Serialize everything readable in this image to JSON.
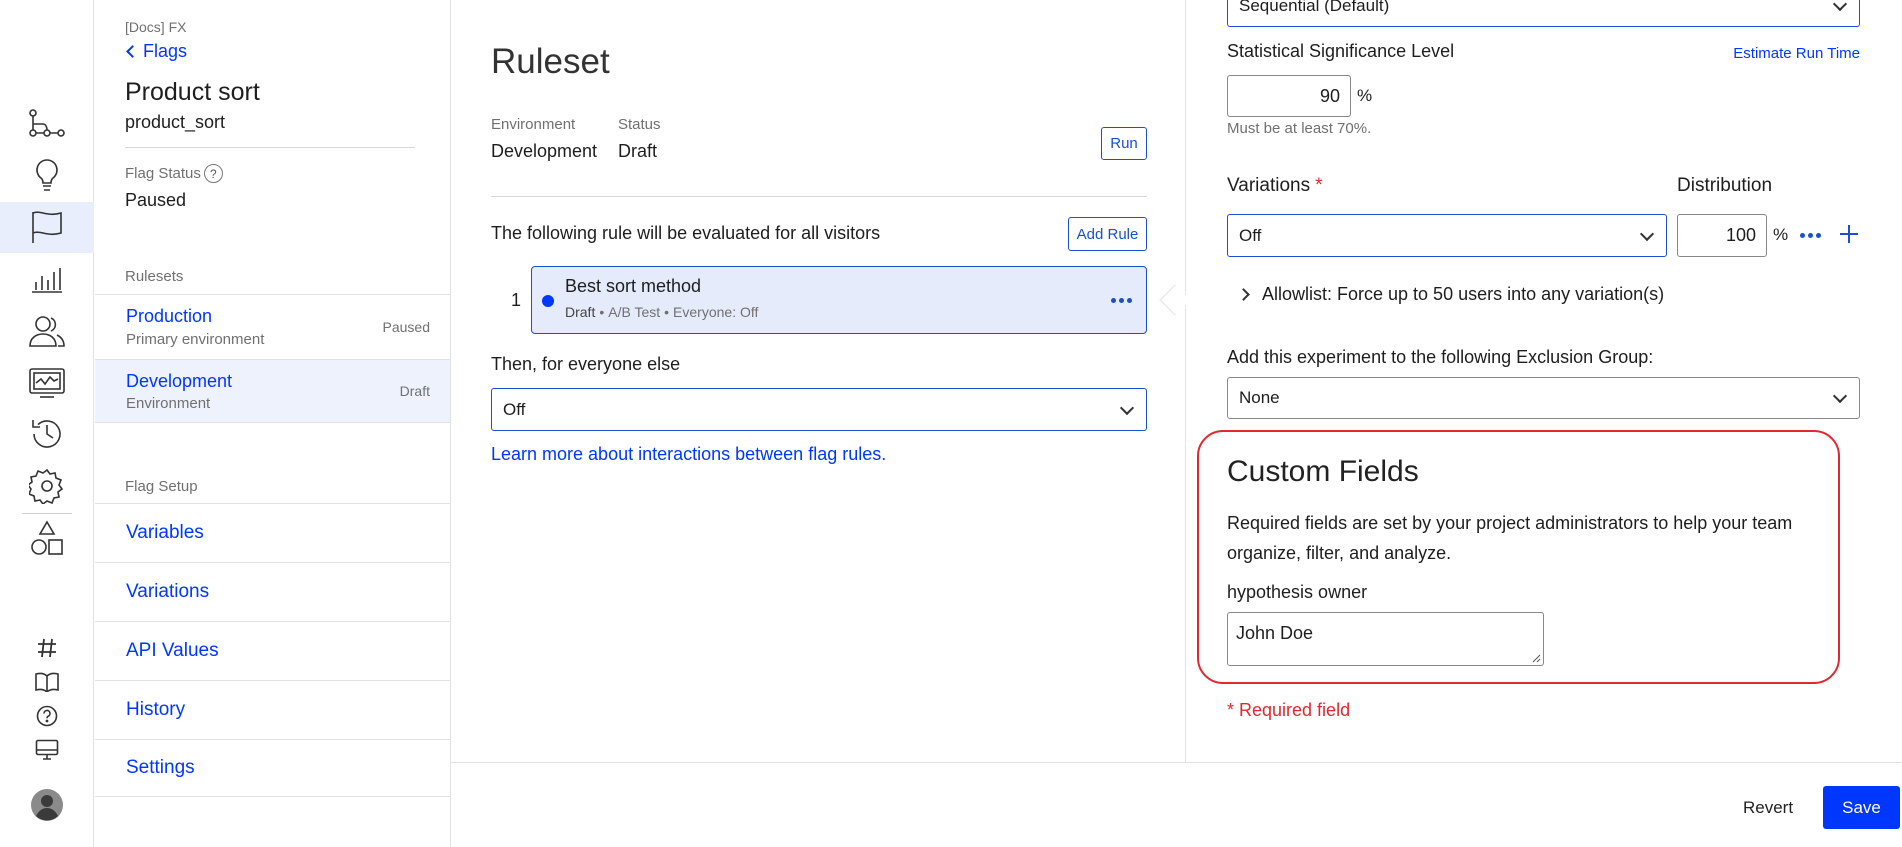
{
  "rail": {
    "icons": [
      "hierarchy-icon",
      "lightbulb-icon",
      "flag-icon",
      "bar-chart-icon",
      "users-icon",
      "monitor-chart-icon",
      "history-icon",
      "gear-icon",
      "shapes-icon",
      "hash-icon",
      "book-icon",
      "help-icon",
      "desktop-icon",
      "avatar-icon"
    ]
  },
  "sidebar": {
    "project": "[Docs] FX",
    "back_link": "Flags",
    "flag_name": "Product sort",
    "flag_key": "product_sort",
    "flag_status_label": "Flag Status",
    "flag_status_value": "Paused",
    "rulesets_heading": "Rulesets",
    "rulesets": [
      {
        "name": "Production",
        "sub": "Primary environment",
        "status": "Paused"
      },
      {
        "name": "Development",
        "sub": "Environment",
        "status": "Draft"
      }
    ],
    "flag_setup_heading": "Flag Setup",
    "setup_links": [
      "Variables",
      "Variations",
      "API Values",
      "History",
      "Settings"
    ]
  },
  "main": {
    "title": "Ruleset",
    "env_label": "Environment",
    "env_value": "Development",
    "status_label": "Status",
    "status_value": "Draft",
    "run_button": "Run",
    "rule_intro": "The following rule will be evaluated for all visitors",
    "add_rule_button": "Add Rule",
    "rule": {
      "index": "1",
      "name": "Best sort method",
      "status": "Draft",
      "type": "A/B Test",
      "audience": "Everyone: Off"
    },
    "everyone_else_label": "Then, for everyone else",
    "everyone_else_value": "Off",
    "learn_more_link": "Learn more about interactions between flag rules."
  },
  "right": {
    "method_value": "Sequential (Default)",
    "significance_label": "Statistical Significance Level",
    "estimate_link": "Estimate Run Time",
    "significance_value": "90",
    "percent": "%",
    "significance_hint": "Must be at least 70%.",
    "variations_label": "Variations",
    "required_star": "*",
    "distribution_label": "Distribution",
    "variation_value": "Off",
    "distribution_value": "100",
    "allowlist_label": "Allowlist: Force up to 50 users into any variation(s)",
    "exclusion_label": "Add this experiment to the following Exclusion Group:",
    "exclusion_value": "None",
    "custom_fields_title": "Custom Fields",
    "custom_fields_desc_1": "Required fields are set by your project administrators to help your team",
    "custom_fields_desc_2": "organize, filter, and analyze.",
    "hypothesis_label": "hypothesis owner",
    "hypothesis_value": "John Doe",
    "required_note": "* Required field",
    "highlight_color": "#e0282e"
  },
  "footer": {
    "revert_button": "Revert",
    "save_button": "Save"
  }
}
